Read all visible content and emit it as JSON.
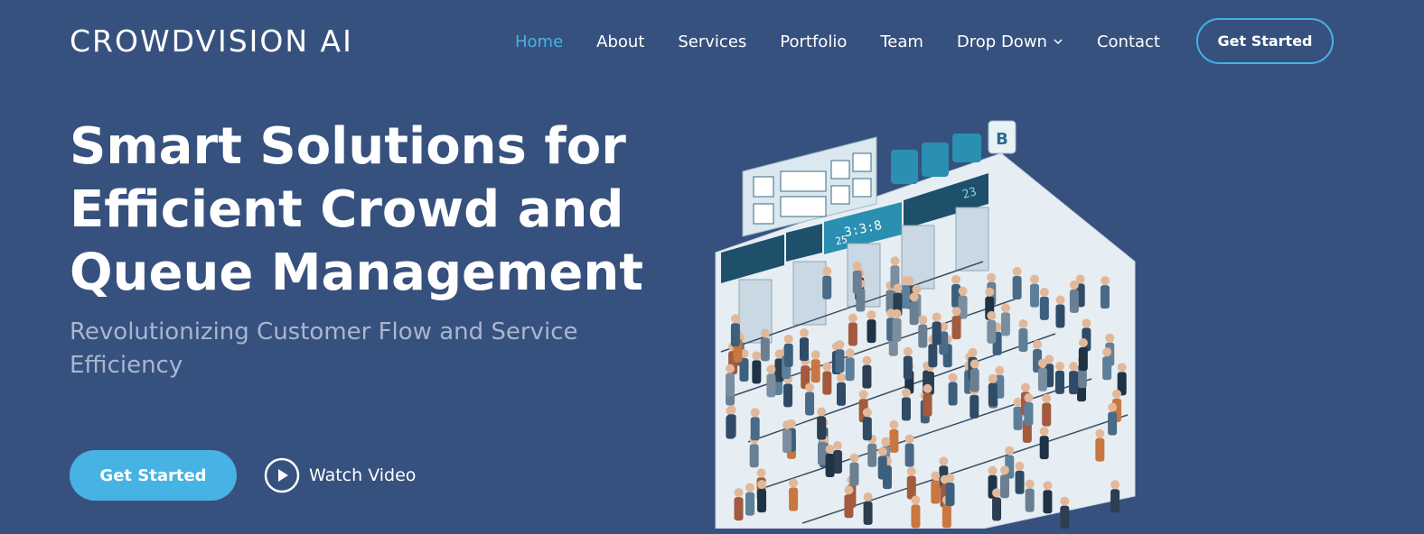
{
  "header": {
    "logo": "CROWDVISION AI",
    "nav": [
      {
        "label": "Home",
        "active": true
      },
      {
        "label": "About"
      },
      {
        "label": "Services"
      },
      {
        "label": "Portfolio"
      },
      {
        "label": "Team"
      },
      {
        "label": "Drop Down"
      },
      {
        "label": "Contact"
      }
    ],
    "cta": "Get Started"
  },
  "hero": {
    "title": "Smart Solutions for Efficient Crowd and Queue Management",
    "subtitle": "Revolutionizing Customer Flow and Service Efficiency",
    "primary_button": "Get Started",
    "video_link": "Watch Video"
  },
  "illustration": {
    "icon": "crowd-queue-illustration",
    "display_panels": [
      "3:3:8",
      "25",
      "23",
      "B"
    ]
  },
  "colors": {
    "background": "#37517e",
    "accent": "#47b2e4",
    "subtitle": "#a9b6cf"
  }
}
